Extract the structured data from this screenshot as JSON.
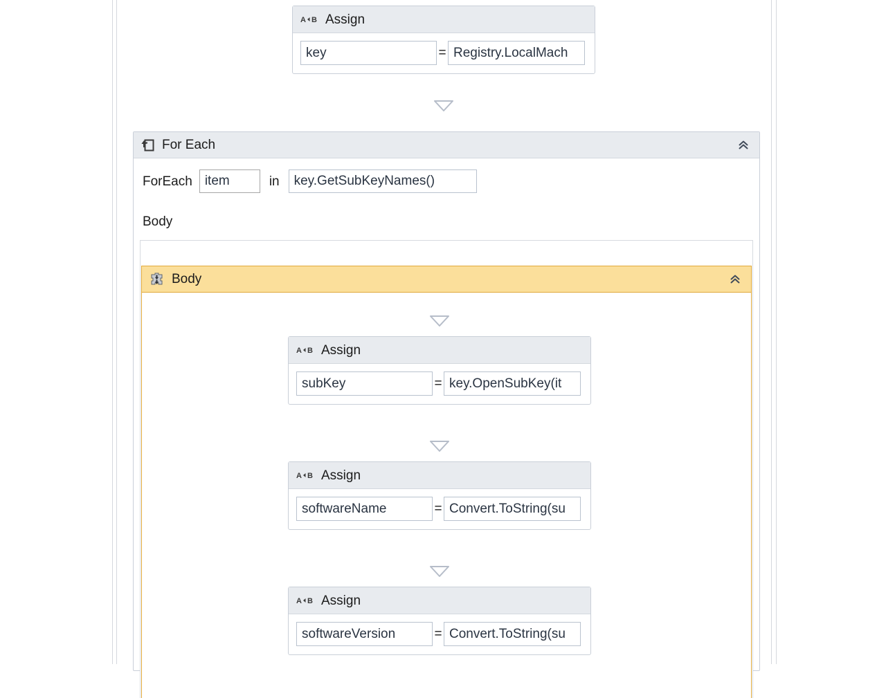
{
  "canvas": {
    "background": "#ffffff",
    "rail_color": "#d5d8de"
  },
  "colors": {
    "header_gray": "#e8ebef",
    "border_gray": "#c9cfd8",
    "highlight_yellow": "#fbdf9b",
    "highlight_border": "#e0a93b",
    "expression_text": "#2a3442",
    "field_border": "#b9c2ce"
  },
  "activities": {
    "assign_top": {
      "icon": "assign-icon",
      "title": "Assign",
      "to_value": "key",
      "operator": "=",
      "value_value": "Registry.LocalMach"
    },
    "for_each": {
      "icon": "for-each-icon",
      "title": "For Each",
      "collapse_icon": "chevron-up-double-icon",
      "prefix_label": "ForEach",
      "variable_value": "item",
      "in_label": "in",
      "collection_value": "key.GetSubKeyNames()",
      "body_caption": "Body",
      "sequence": {
        "icon": "sequence-icon",
        "title": "Body",
        "collapse_icon": "chevron-up-double-icon",
        "children": [
          {
            "icon": "assign-icon",
            "title": "Assign",
            "to_value": "subKey",
            "operator": "=",
            "value_value": "key.OpenSubKey(it"
          },
          {
            "icon": "assign-icon",
            "title": "Assign",
            "to_value": "softwareName",
            "operator": "=",
            "value_value": "Convert.ToString(su"
          },
          {
            "icon": "assign-icon",
            "title": "Assign",
            "to_value": "softwareVersion",
            "operator": "=",
            "value_value": "Convert.ToString(su"
          }
        ]
      }
    }
  }
}
